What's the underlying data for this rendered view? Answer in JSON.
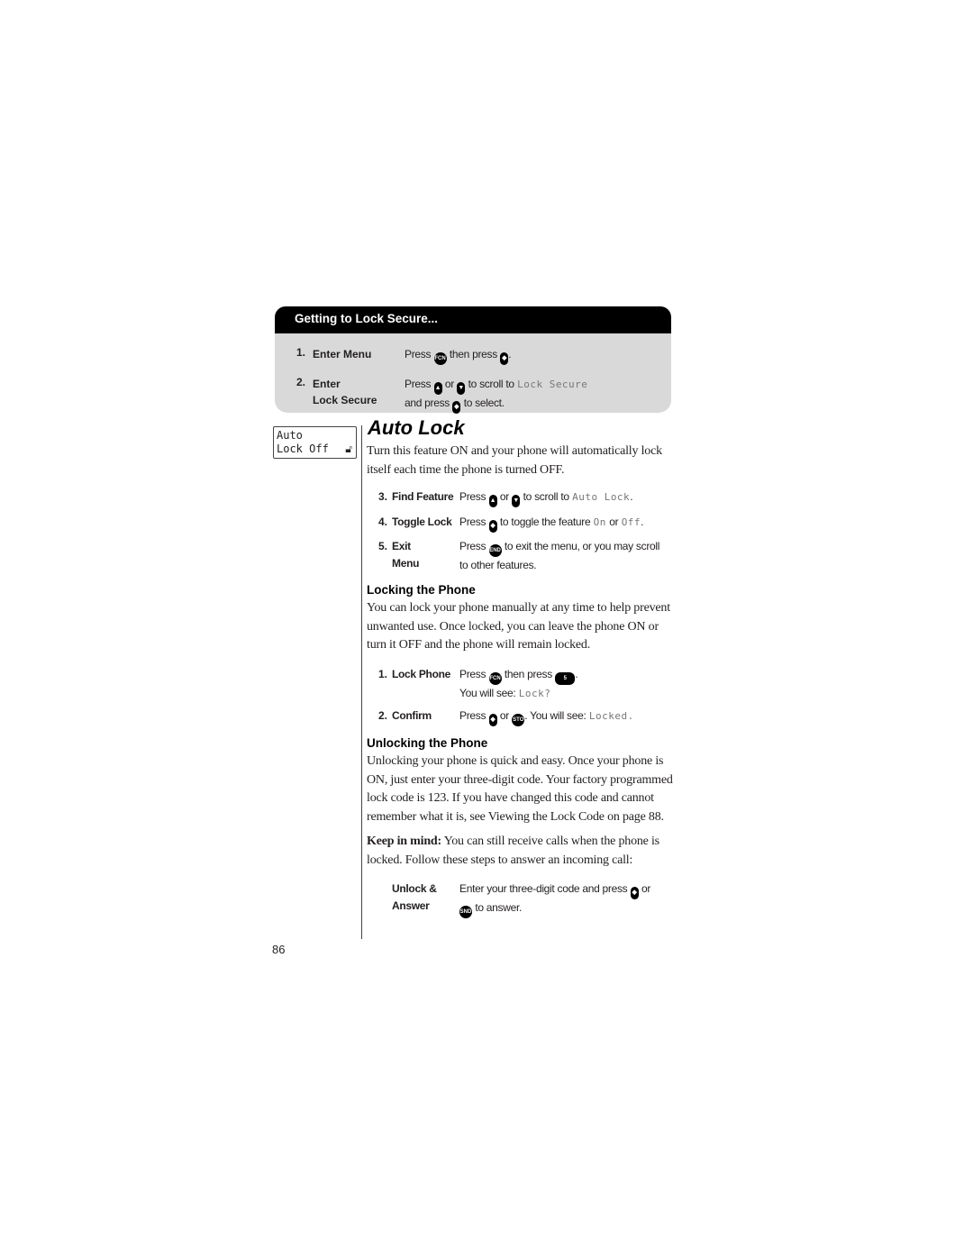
{
  "getting_box": {
    "title": "Getting to Lock Secure...",
    "steps": [
      {
        "num": "1.",
        "label": "Enter Menu",
        "parts": [
          "Press",
          "then press",
          "."
        ]
      },
      {
        "num": "2.",
        "label_line1": "Enter",
        "label_line2": "Lock Secure",
        "line1": [
          "Press",
          "or",
          "to scroll to",
          "Lock Secure"
        ],
        "line2": [
          "and press",
          "to select."
        ]
      }
    ]
  },
  "display": {
    "line1": "Auto",
    "line2": "Lock Off",
    "icon": "unlocked-padlock-icon"
  },
  "section": {
    "title": "Auto Lock",
    "intro": "Turn this feature ON and your phone will automatically lock itself each time the phone is turned OFF.",
    "steps": [
      {
        "num": "3.",
        "label": "Find Feature",
        "parts": [
          "Press",
          "or",
          "to scroll to",
          "Auto Lock",
          "."
        ]
      },
      {
        "num": "4.",
        "label": "Toggle Lock",
        "parts": [
          "Press",
          "to toggle the feature",
          "On",
          "or",
          "Off",
          "."
        ]
      },
      {
        "num": "5.",
        "label_line1": "Exit",
        "label_line2": "Menu",
        "line1": [
          "Press",
          "to exit the menu, or you may scroll"
        ],
        "line2": "to other features."
      }
    ]
  },
  "locking": {
    "heading": "Locking the Phone",
    "text": "You can lock your phone manually at any time to help prevent unwanted use. Once locked, you can leave the phone ON or turn it OFF and the phone will remain locked.",
    "steps": [
      {
        "num": "1.",
        "label": "Lock Phone",
        "line1": [
          "Press",
          "then press",
          "."
        ],
        "line2": [
          "You will see:",
          "Lock?"
        ]
      },
      {
        "num": "2.",
        "label": "Confirm",
        "parts": [
          "Press",
          "or",
          ". You will see:",
          "Locked."
        ]
      }
    ]
  },
  "unlocking": {
    "heading": "Unlocking the Phone",
    "text": "Unlocking your phone is quick and easy. Once your phone is ON, just enter your three-digit code. Your factory programmed lock code is 123. If you have changed this code and cannot remember what it is, see Viewing the Lock Code on page 88.",
    "keep_label": "Keep in mind:",
    "keep_text": " You can still receive calls when the phone is locked. Follow these steps to answer an incoming call:",
    "step": {
      "label_line1": "Unlock &",
      "label_line2": "Answer",
      "line1": [
        "Enter your three-digit code and press",
        "or"
      ],
      "line2": "to answer."
    }
  },
  "keys": {
    "fcn": "FCN",
    "end": "END",
    "snd": "SND",
    "five": "5",
    "sto": "STO"
  },
  "page_number": "86"
}
